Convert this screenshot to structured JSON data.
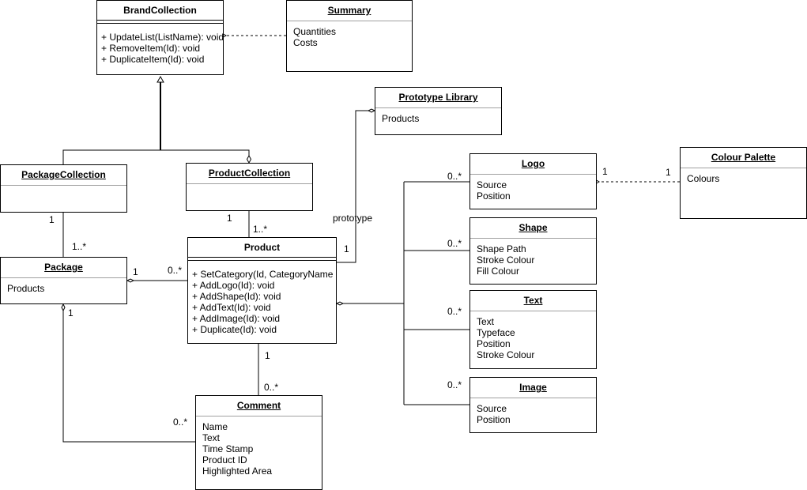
{
  "diagram": {
    "type": "UML class diagram",
    "classes": {
      "brand_collection": {
        "name": "BrandCollection",
        "attributes": [],
        "operations": [
          "+ UpdateList(ListName): void",
          "+ RemoveItem(Id): void",
          "+ DuplicateItem(Id): void"
        ]
      },
      "summary": {
        "name": "Summary",
        "attributes": [
          "Quantities",
          "Costs"
        ]
      },
      "prototype_library": {
        "name": "Prototype Library",
        "attributes": [
          "Products"
        ]
      },
      "package_collection": {
        "name": "PackageCollection",
        "attributes": []
      },
      "product_collection": {
        "name": "ProductCollection",
        "attributes": []
      },
      "package": {
        "name": "Package",
        "attributes": [
          "Products"
        ]
      },
      "product": {
        "name": "Product",
        "attributes": [],
        "operations": [
          "+ SetCategory(Id, CategoryName",
          "+ AddLogo(Id): void",
          "+ AddShape(Id): void",
          "+ AddText(Id): void",
          "+ AddImage(Id): void",
          "+ Duplicate(Id): void"
        ]
      },
      "comment": {
        "name": "Comment",
        "attributes": [
          "Name",
          "Text",
          "Time Stamp",
          "Product ID",
          "Highlighted Area"
        ]
      },
      "logo": {
        "name": "Logo",
        "attributes": [
          "Source",
          "Position"
        ]
      },
      "shape": {
        "name": "Shape",
        "attributes": [
          "Shape Path",
          "Stroke Colour",
          "Fill Colour"
        ]
      },
      "text": {
        "name": "Text",
        "attributes": [
          "Text",
          "Typeface",
          "Position",
          "Stroke Colour"
        ]
      },
      "image": {
        "name": "Image",
        "attributes": [
          "Source",
          "Position"
        ]
      },
      "colour_palette": {
        "name": "Colour Palette",
        "attributes": [
          "Colours"
        ]
      }
    },
    "relationships": [
      {
        "from": "Summary",
        "to": "BrandCollection",
        "kind": "dependency"
      },
      {
        "from": "PackageCollection",
        "to": "BrandCollection",
        "kind": "generalization"
      },
      {
        "from": "ProductCollection",
        "to": "BrandCollection",
        "kind": "generalization"
      },
      {
        "from": "PackageCollection",
        "to": "Package",
        "kind": "association",
        "from_mult": "1",
        "to_mult": "1..*"
      },
      {
        "from": "ProductCollection",
        "to": "Product",
        "kind": "association",
        "from_mult": "1",
        "to_mult": "1..*"
      },
      {
        "from": "Package",
        "to": "Product",
        "kind": "aggregation",
        "from_mult": "1",
        "to_mult": "0..*"
      },
      {
        "from": "Prototype Library",
        "to": "Product",
        "kind": "aggregation",
        "label": "prototype",
        "to_mult": "1"
      },
      {
        "from": "Product",
        "to": "Comment",
        "kind": "association",
        "from_mult": "1",
        "to_mult": "0..*"
      },
      {
        "from": "Package",
        "to": "Comment",
        "kind": "aggregation",
        "from_mult": "1",
        "to_mult": "0..*"
      },
      {
        "from": "Product",
        "to": "Logo",
        "kind": "aggregation",
        "to_mult": "0..*"
      },
      {
        "from": "Product",
        "to": "Shape",
        "kind": "aggregation",
        "to_mult": "0..*"
      },
      {
        "from": "Product",
        "to": "Text",
        "kind": "aggregation",
        "to_mult": "0..*"
      },
      {
        "from": "Product",
        "to": "Image",
        "kind": "aggregation",
        "to_mult": "0..*"
      },
      {
        "from": "Colour Palette",
        "to": "Logo",
        "kind": "dependency",
        "from_mult": "1",
        "to_mult": "1"
      }
    ]
  },
  "labels": {
    "pkgcoll_pkg_top": "1",
    "pkgcoll_pkg_bottom": "1..*",
    "prodcoll_prod_top": "1",
    "prodcoll_prod_bottom": "1..*",
    "pkg_prod_left": "1",
    "pkg_prod_right": "0..*",
    "prototype": "prototype",
    "proto_prod": "1",
    "prod_comment_top": "1",
    "prod_comment_bottom": "0..*",
    "pkg_comment_top": "1",
    "pkg_comment_bottom": "0..*",
    "logo_mult": "0..*",
    "shape_mult": "0..*",
    "text_mult": "0..*",
    "image_mult": "0..*",
    "palette_logo_left": "1",
    "palette_logo_right": "1"
  }
}
